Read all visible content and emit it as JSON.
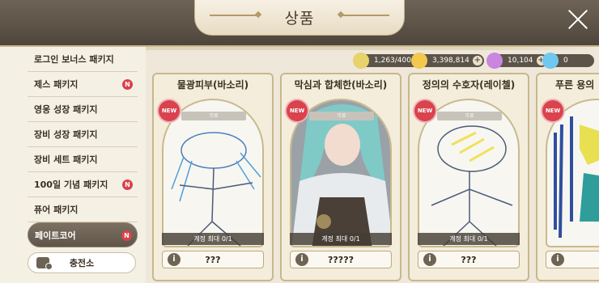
{
  "header": {
    "title": "상품"
  },
  "sidebar": {
    "items": [
      {
        "label": "로그인 보너스 패키지",
        "badge": ""
      },
      {
        "label": "제스 패키지",
        "badge": "N"
      },
      {
        "label": "영웅 성장 패키지",
        "badge": ""
      },
      {
        "label": "장비 성장 패키지",
        "badge": ""
      },
      {
        "label": "장비 세트 패키지",
        "badge": ""
      },
      {
        "label": "100일 기념 패키지",
        "badge": "N"
      },
      {
        "label": "퓨어 패키지",
        "badge": ""
      },
      {
        "label": "페이트코어",
        "badge": "N"
      }
    ],
    "charge_label": "충전소"
  },
  "currency": [
    {
      "name": "stamina",
      "value": "1,263/400+",
      "color": "#e8d36a"
    },
    {
      "name": "gold",
      "value": "3,398,814",
      "color": "#f2c94c"
    },
    {
      "name": "gem",
      "value": "10,104",
      "color": "#c985e0"
    },
    {
      "name": "crystal",
      "value": "0",
      "color": "#6fc8ef"
    }
  ],
  "cards": [
    {
      "title": "물광피부(바소리)",
      "new": "NEW",
      "rank": "무료",
      "limit": "계정 최대 0/1",
      "price": "???"
    },
    {
      "title": "막심과 합체한(바소리)",
      "new": "NEW",
      "rank": "무료",
      "limit": "계정 최대 0/1",
      "price": "?????"
    },
    {
      "title": "정의의 수호자(레이첼)",
      "new": "NEW",
      "rank": "무료",
      "limit": "계정 최대 0/1",
      "price": "???"
    },
    {
      "title": "푸른 용의",
      "new": "NEW",
      "rank": "",
      "limit": "",
      "price": ""
    }
  ],
  "info_icon": "i"
}
